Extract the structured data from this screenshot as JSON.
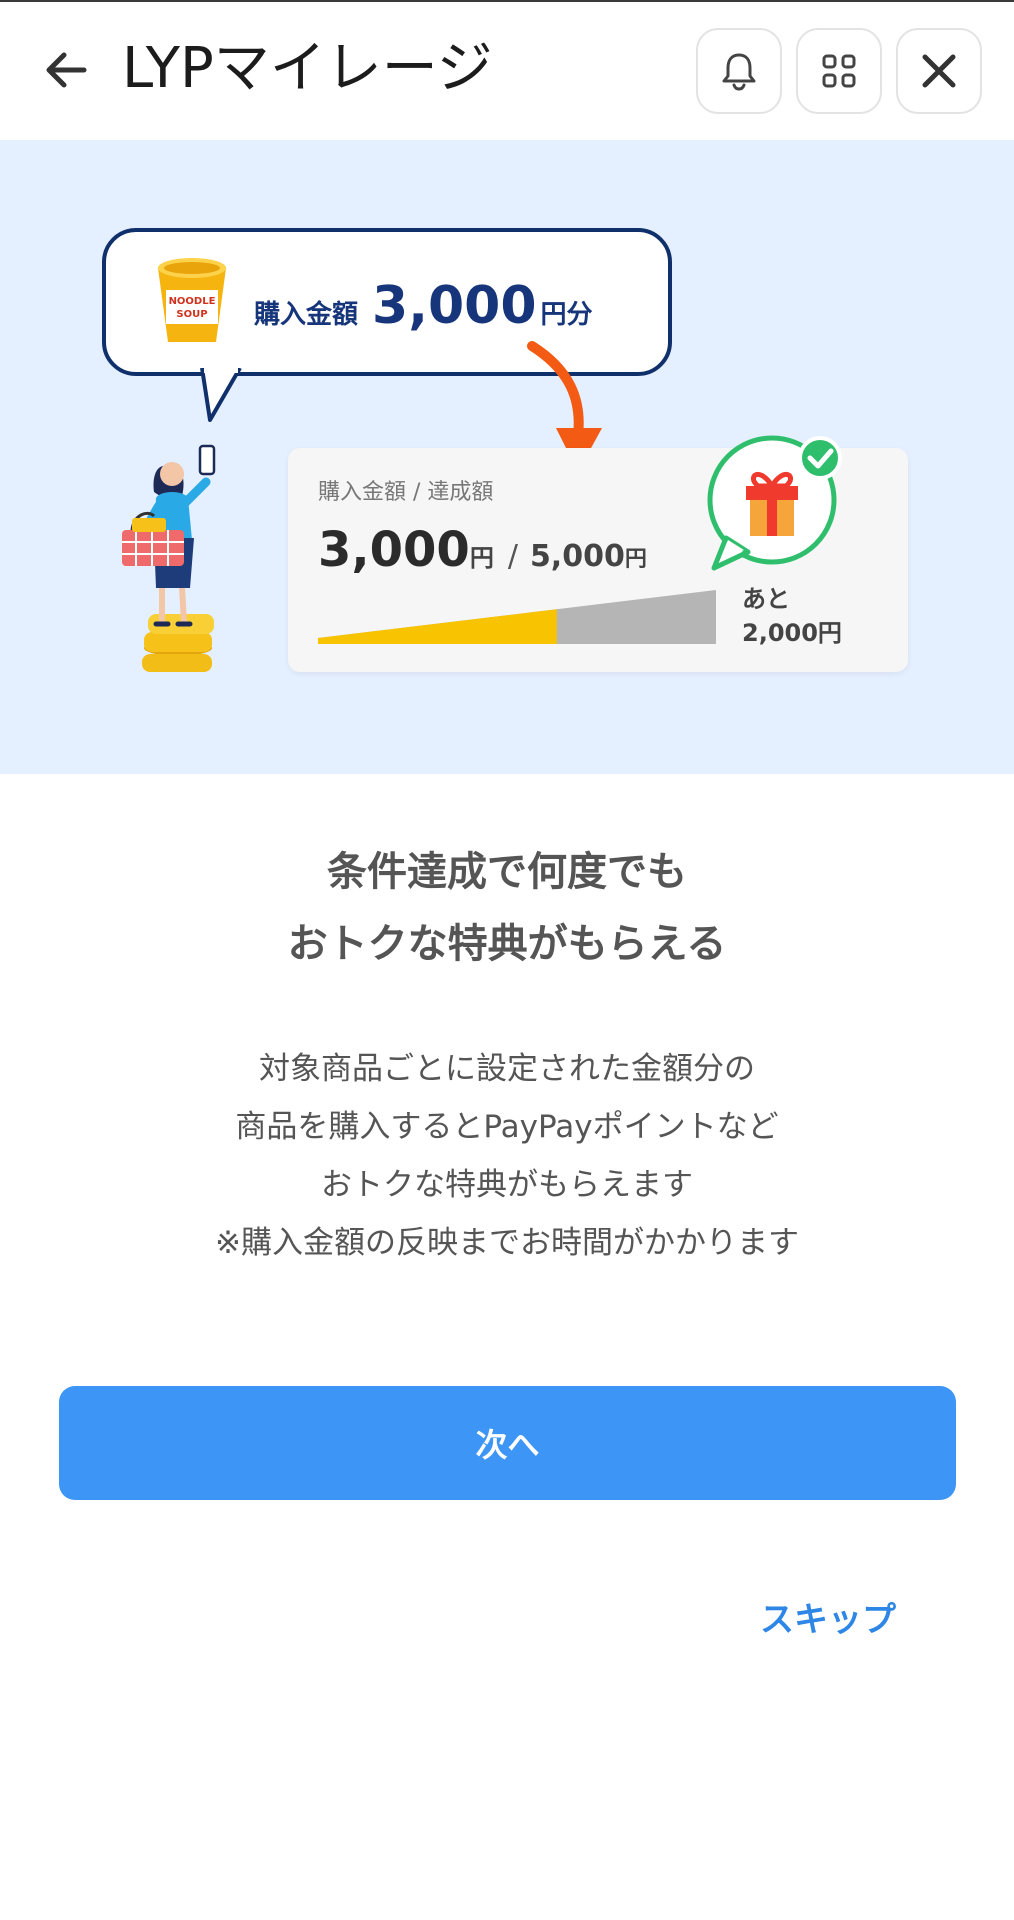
{
  "header": {
    "title": "LYPマイレージ",
    "icons": [
      "arrow-left-icon",
      "bell-icon",
      "grid-icon",
      "close-icon"
    ]
  },
  "hero": {
    "bubble": {
      "label": "購入金額",
      "amount": "3,000",
      "unit": "円分"
    },
    "card": {
      "label": "購入金額 / 達成額",
      "current": "3,000",
      "current_unit": "円",
      "separator": "/",
      "goal": "5,000",
      "goal_unit": "円",
      "progress": 0.6,
      "remaining_label": "あと",
      "remaining_value": "2,000円"
    },
    "bubble_product_text": "NOODLE SOUP"
  },
  "headline": {
    "line1": "条件達成で何度でも",
    "line2": "おトクな特典がもらえる"
  },
  "description": {
    "line1": "対象商品ごとに設定された金額分の",
    "line2": "商品を購入するとPayPayポイントなど",
    "line3": "おトクな特典がもらえます",
    "line4": "※購入金額の反映までお時間がかかります"
  },
  "actions": {
    "next_label": "次へ",
    "skip_label": "スキップ"
  },
  "colors": {
    "accent": "#3d95f6",
    "hero_bg": "#e4efff",
    "navy": "#10306b",
    "progress_fill": "#f8c300",
    "progress_rest": "#b5b5b5",
    "arrow": "#f35a14",
    "gift_ring": "#2fbf6c"
  }
}
